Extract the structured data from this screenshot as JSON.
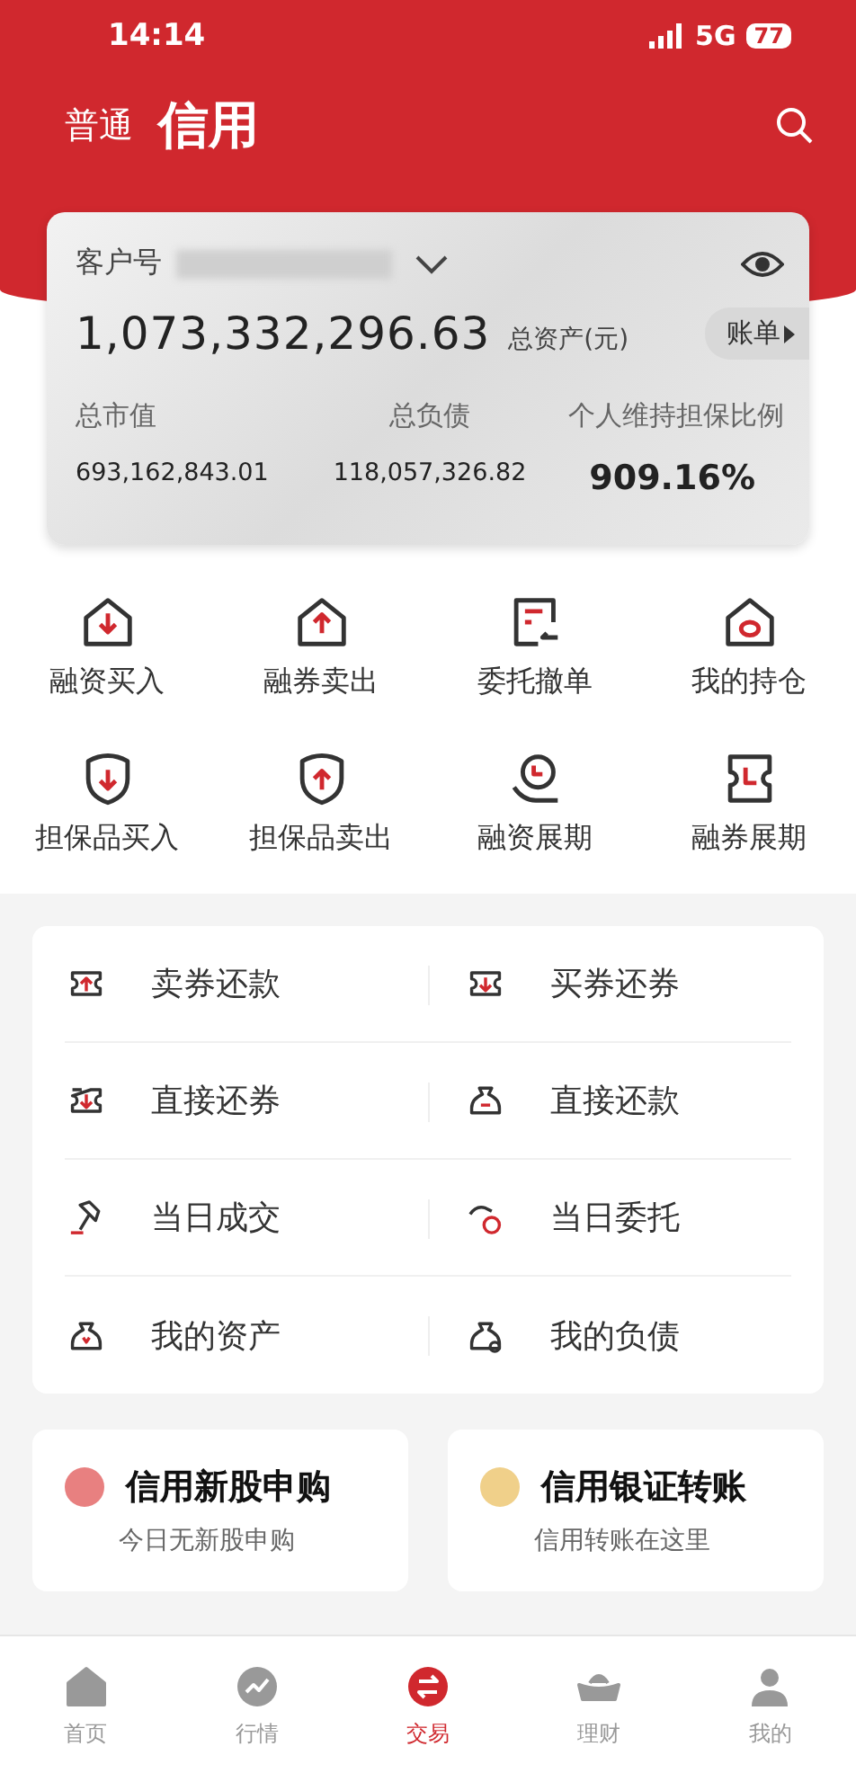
{
  "status_bar": {
    "time": "14:14",
    "network": "5G",
    "battery": "77"
  },
  "header": {
    "tabs": [
      {
        "label": "普通",
        "selected": false
      },
      {
        "label": "信用",
        "selected": true
      }
    ]
  },
  "account_card": {
    "customer_label": "客户号",
    "total_assets": "1,073,332,296.63",
    "total_assets_label": "总资产(元)",
    "statement_button": "账单",
    "stats": [
      {
        "label": "总市值",
        "value": "693,162,843.01"
      },
      {
        "label": "总负债",
        "value": "118,057,326.82"
      },
      {
        "label": "个人维持担保比例",
        "value": "909.16%"
      }
    ]
  },
  "quick_actions": [
    "融资买入",
    "融券卖出",
    "委托撤单",
    "我的持仓",
    "担保品买入",
    "担保品卖出",
    "融资展期",
    "融券展期"
  ],
  "menu_list": [
    "卖券还款",
    "买券还券",
    "直接还券",
    "直接还款",
    "当日成交",
    "当日委托",
    "我的资产",
    "我的负债"
  ],
  "promos": [
    {
      "title": "信用新股申购",
      "subtitle": "今日无新股申购",
      "color": "#e88080"
    },
    {
      "title": "信用银证转账",
      "subtitle": "信用转账在这里",
      "color": "#f0d08a"
    }
  ],
  "tab_bar": [
    {
      "label": "首页",
      "selected": false
    },
    {
      "label": "行情",
      "selected": false
    },
    {
      "label": "交易",
      "selected": true
    },
    {
      "label": "理财",
      "selected": false
    },
    {
      "label": "我的",
      "selected": false
    }
  ]
}
